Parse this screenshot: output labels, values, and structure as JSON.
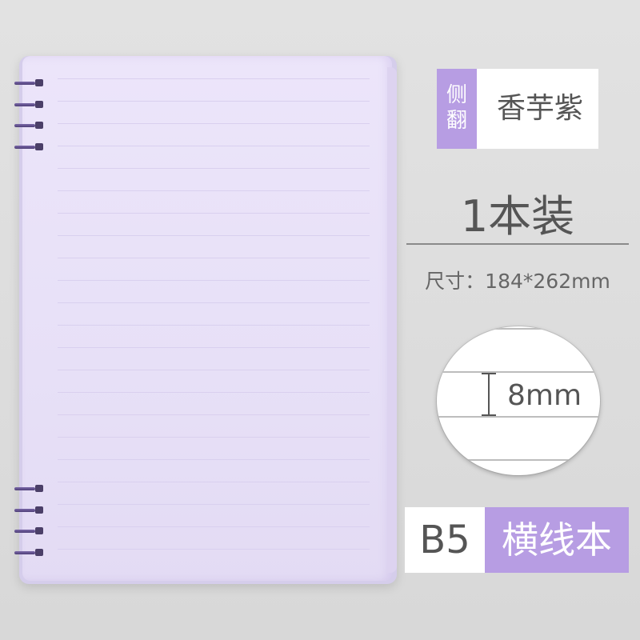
{
  "tag": {
    "side_top": "侧",
    "side_bottom": "翻",
    "main": "香芋紫"
  },
  "quantity": "1本装",
  "size_text": "尺寸：184*262mm",
  "line_spacing_label": "8mm",
  "format": {
    "size": "B5",
    "type": "横线本"
  },
  "colors": {
    "accent": "#b79de3",
    "cover": "#ebe4f9",
    "text": "#555555"
  }
}
